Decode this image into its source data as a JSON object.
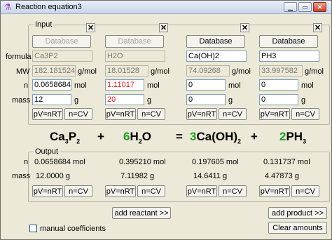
{
  "window": {
    "title": "Reaction equation3",
    "icon": "flask-icon"
  },
  "input_group": {
    "label": "Input"
  },
  "output_group": {
    "label": "Output"
  },
  "row_labels": {
    "formula": "formula",
    "mw": "MW",
    "n": "n",
    "mass": "mass"
  },
  "units": {
    "mw": "g/mol",
    "n": "mol",
    "mass": "g"
  },
  "buttons": {
    "database": "Database",
    "pv": "pV=nRT",
    "ncv": "n=CV",
    "close": "✕"
  },
  "species": [
    {
      "formula": "Ca3P2",
      "mw": "182.181524",
      "n": "0.0658684",
      "mass": "12",
      "db_enabled": false
    },
    {
      "formula": "H2O",
      "mw": "18.01528",
      "n": "1.11017",
      "mass": "20",
      "db_enabled": false
    },
    {
      "formula": "Ca(OH)2",
      "mw": "74.09268",
      "n": "0",
      "mass": "0",
      "db_enabled": true
    },
    {
      "formula": "PH3",
      "mw": "33.997582",
      "n": "0",
      "mass": "0",
      "db_enabled": true
    }
  ],
  "equation": {
    "plus": "+",
    "equals": "=",
    "terms": [
      {
        "coef": "",
        "parts": [
          "Ca",
          "3",
          "P",
          "2"
        ]
      },
      {
        "coef": "6",
        "parts": [
          "H",
          "2",
          "O"
        ]
      },
      {
        "coef": "3",
        "parts": [
          "Ca(OH)",
          "2"
        ]
      },
      {
        "coef": "2",
        "parts": [
          "PH",
          "3"
        ]
      }
    ]
  },
  "output": {
    "n": [
      "0.0658684 mol",
      "0.395210 mol",
      "0.197605 mol",
      "0.131737 mol"
    ],
    "mass": [
      "12.0000 g",
      "7.11982 g",
      "14.6411 g",
      "4.47873 g"
    ]
  },
  "actions": {
    "add_reactant": "add reactant >>",
    "add_product": "add product >>",
    "clear": "Clear amounts",
    "manual_coefficients": "manual coefficients",
    "manual_checked": false
  },
  "colors": {
    "coefficient": "#1ea01e",
    "highlight_value": "#e02020"
  }
}
